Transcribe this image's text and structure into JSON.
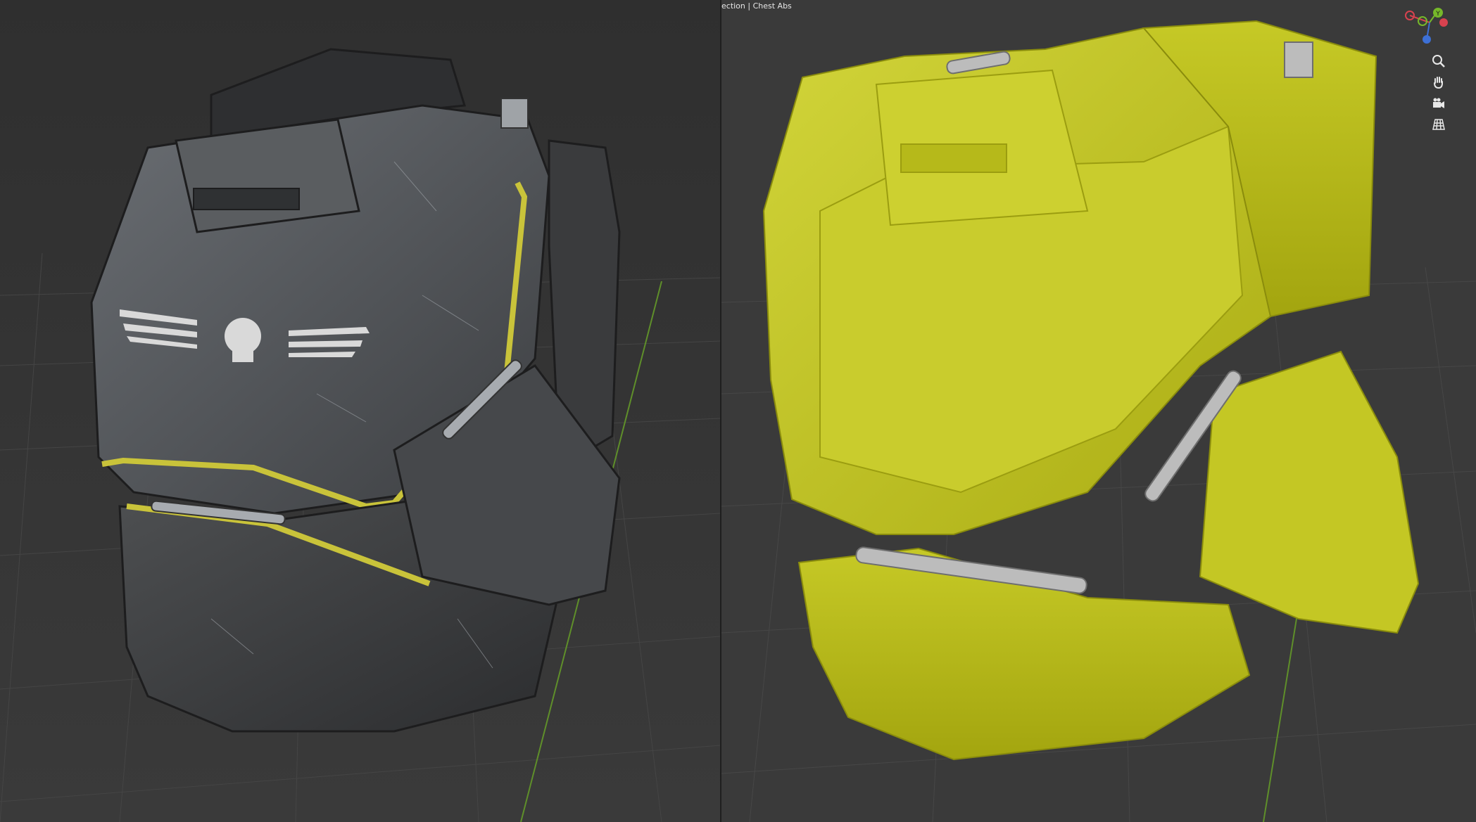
{
  "header": {
    "title": "ection | Chest Abs"
  },
  "navigation_gizmo": {
    "axis_y_label": "Y"
  },
  "nav_tools": [
    {
      "name": "zoom-icon"
    },
    {
      "name": "hand-pan-icon"
    },
    {
      "name": "camera-view-icon"
    },
    {
      "name": "perspective-grid-icon"
    }
  ],
  "colors": {
    "viewport_bg": "#393939",
    "armor_gray": "#54575a",
    "armor_yellow": "#c2c52a",
    "trim_yellow": "#c9c33a",
    "metal": "#b9b9b9",
    "axis_x": "#d8424f",
    "axis_y": "#76b82a",
    "axis_z": "#3d70d6"
  }
}
